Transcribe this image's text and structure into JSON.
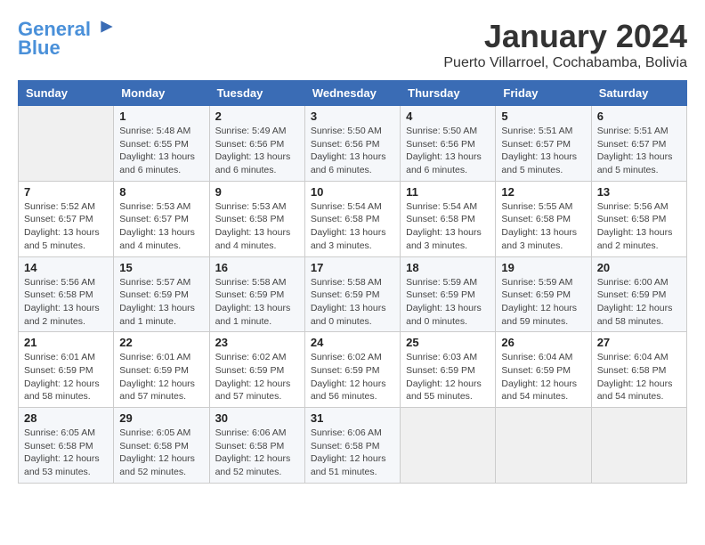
{
  "header": {
    "logo_line1": "General",
    "logo_line2": "Blue",
    "month": "January 2024",
    "location": "Puerto Villarroel, Cochabamba, Bolivia"
  },
  "days_of_week": [
    "Sunday",
    "Monday",
    "Tuesday",
    "Wednesday",
    "Thursday",
    "Friday",
    "Saturday"
  ],
  "weeks": [
    [
      {
        "day": "",
        "info": ""
      },
      {
        "day": "1",
        "info": "Sunrise: 5:48 AM\nSunset: 6:55 PM\nDaylight: 13 hours and 6 minutes."
      },
      {
        "day": "2",
        "info": "Sunrise: 5:49 AM\nSunset: 6:56 PM\nDaylight: 13 hours and 6 minutes."
      },
      {
        "day": "3",
        "info": "Sunrise: 5:50 AM\nSunset: 6:56 PM\nDaylight: 13 hours and 6 minutes."
      },
      {
        "day": "4",
        "info": "Sunrise: 5:50 AM\nSunset: 6:56 PM\nDaylight: 13 hours and 6 minutes."
      },
      {
        "day": "5",
        "info": "Sunrise: 5:51 AM\nSunset: 6:57 PM\nDaylight: 13 hours and 5 minutes."
      },
      {
        "day": "6",
        "info": "Sunrise: 5:51 AM\nSunset: 6:57 PM\nDaylight: 13 hours and 5 minutes."
      }
    ],
    [
      {
        "day": "7",
        "info": "Sunrise: 5:52 AM\nSunset: 6:57 PM\nDaylight: 13 hours and 5 minutes."
      },
      {
        "day": "8",
        "info": "Sunrise: 5:53 AM\nSunset: 6:57 PM\nDaylight: 13 hours and 4 minutes."
      },
      {
        "day": "9",
        "info": "Sunrise: 5:53 AM\nSunset: 6:58 PM\nDaylight: 13 hours and 4 minutes."
      },
      {
        "day": "10",
        "info": "Sunrise: 5:54 AM\nSunset: 6:58 PM\nDaylight: 13 hours and 3 minutes."
      },
      {
        "day": "11",
        "info": "Sunrise: 5:54 AM\nSunset: 6:58 PM\nDaylight: 13 hours and 3 minutes."
      },
      {
        "day": "12",
        "info": "Sunrise: 5:55 AM\nSunset: 6:58 PM\nDaylight: 13 hours and 3 minutes."
      },
      {
        "day": "13",
        "info": "Sunrise: 5:56 AM\nSunset: 6:58 PM\nDaylight: 13 hours and 2 minutes."
      }
    ],
    [
      {
        "day": "14",
        "info": "Sunrise: 5:56 AM\nSunset: 6:58 PM\nDaylight: 13 hours and 2 minutes."
      },
      {
        "day": "15",
        "info": "Sunrise: 5:57 AM\nSunset: 6:59 PM\nDaylight: 13 hours and 1 minute."
      },
      {
        "day": "16",
        "info": "Sunrise: 5:58 AM\nSunset: 6:59 PM\nDaylight: 13 hours and 1 minute."
      },
      {
        "day": "17",
        "info": "Sunrise: 5:58 AM\nSunset: 6:59 PM\nDaylight: 13 hours and 0 minutes."
      },
      {
        "day": "18",
        "info": "Sunrise: 5:59 AM\nSunset: 6:59 PM\nDaylight: 13 hours and 0 minutes."
      },
      {
        "day": "19",
        "info": "Sunrise: 5:59 AM\nSunset: 6:59 PM\nDaylight: 12 hours and 59 minutes."
      },
      {
        "day": "20",
        "info": "Sunrise: 6:00 AM\nSunset: 6:59 PM\nDaylight: 12 hours and 58 minutes."
      }
    ],
    [
      {
        "day": "21",
        "info": "Sunrise: 6:01 AM\nSunset: 6:59 PM\nDaylight: 12 hours and 58 minutes."
      },
      {
        "day": "22",
        "info": "Sunrise: 6:01 AM\nSunset: 6:59 PM\nDaylight: 12 hours and 57 minutes."
      },
      {
        "day": "23",
        "info": "Sunrise: 6:02 AM\nSunset: 6:59 PM\nDaylight: 12 hours and 57 minutes."
      },
      {
        "day": "24",
        "info": "Sunrise: 6:02 AM\nSunset: 6:59 PM\nDaylight: 12 hours and 56 minutes."
      },
      {
        "day": "25",
        "info": "Sunrise: 6:03 AM\nSunset: 6:59 PM\nDaylight: 12 hours and 55 minutes."
      },
      {
        "day": "26",
        "info": "Sunrise: 6:04 AM\nSunset: 6:59 PM\nDaylight: 12 hours and 54 minutes."
      },
      {
        "day": "27",
        "info": "Sunrise: 6:04 AM\nSunset: 6:58 PM\nDaylight: 12 hours and 54 minutes."
      }
    ],
    [
      {
        "day": "28",
        "info": "Sunrise: 6:05 AM\nSunset: 6:58 PM\nDaylight: 12 hours and 53 minutes."
      },
      {
        "day": "29",
        "info": "Sunrise: 6:05 AM\nSunset: 6:58 PM\nDaylight: 12 hours and 52 minutes."
      },
      {
        "day": "30",
        "info": "Sunrise: 6:06 AM\nSunset: 6:58 PM\nDaylight: 12 hours and 52 minutes."
      },
      {
        "day": "31",
        "info": "Sunrise: 6:06 AM\nSunset: 6:58 PM\nDaylight: 12 hours and 51 minutes."
      },
      {
        "day": "",
        "info": ""
      },
      {
        "day": "",
        "info": ""
      },
      {
        "day": "",
        "info": ""
      }
    ]
  ]
}
